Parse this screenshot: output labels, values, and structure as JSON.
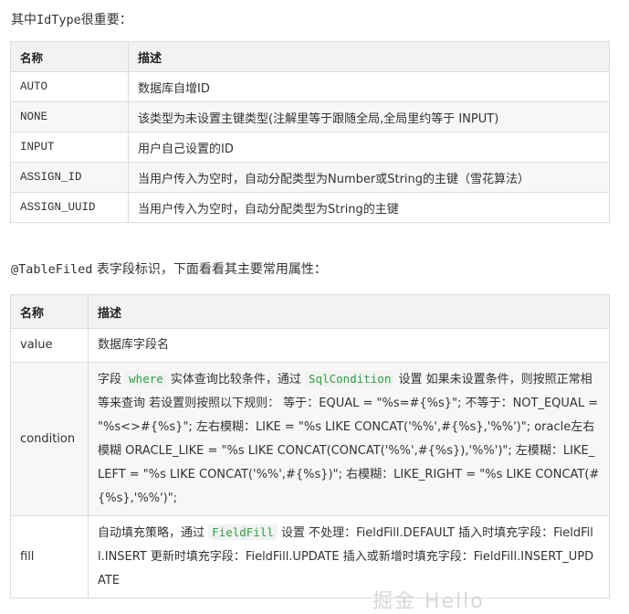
{
  "intro1": {
    "prefix": "其中",
    "code": "IdType",
    "suffix": "很重要："
  },
  "table1": {
    "headers": [
      "名称",
      "描述"
    ],
    "rows": [
      [
        "AUTO",
        "数据库自增ID"
      ],
      [
        "NONE",
        "该类型为未设置主键类型(注解里等于跟随全局,全局里约等于 INPUT)"
      ],
      [
        "INPUT",
        "用户自己设置的ID"
      ],
      [
        "ASSIGN_ID",
        "当用户传入为空时，自动分配类型为Number或String的主键（雪花算法）"
      ],
      [
        "ASSIGN_UUID",
        "当用户传入为空时，自动分配类型为String的主键"
      ]
    ]
  },
  "intro2": {
    "code": "@TableFiled",
    "suffix": " 表字段标识，下面看看其主要常用属性："
  },
  "table2": {
    "headers": [
      "名称",
      "描述"
    ],
    "value": {
      "name": "value",
      "desc": "数据库字段名"
    },
    "condition": {
      "name": "condition",
      "t1": "字段 ",
      "c1": "where",
      "t2": " 实体查询比较条件，通过 ",
      "c2": "SqlCondition",
      "t3": " 设置 如果未设置条件，则按照正常相等来查询 若设置则按照以下规则： 等于：EQUAL = \"%s=#{%s}\"; 不等于：NOT_EQUAL = \"%s<>#{%s}\"; 左右模糊：LIKE = \"%s LIKE CONCAT('%%',#{%s},'%%')\"; oracle左右模糊 ORACLE_LIKE = \"%s LIKE CONCAT(CONCAT('%%',#{%s}),'%%')\"; 左模糊：LIKE_LEFT = \"%s LIKE CONCAT('%%',#{%s})\"; 右模糊：LIKE_RIGHT = \"%s LIKE CONCAT(#{%s},'%%')\";"
    },
    "fill": {
      "name": "fill",
      "t1": "自动填充策略，通过 ",
      "c1": "FieldFill",
      "t2": " 设置 不处理：FieldFill.DEFAULT 插入时填充字段：FieldFill.INSERT 更新时填充字段：FieldFill.UPDATE 插入或新增时填充字段：FieldFill.INSERT_UPDATE"
    }
  },
  "watermark": "掘金 Hello"
}
